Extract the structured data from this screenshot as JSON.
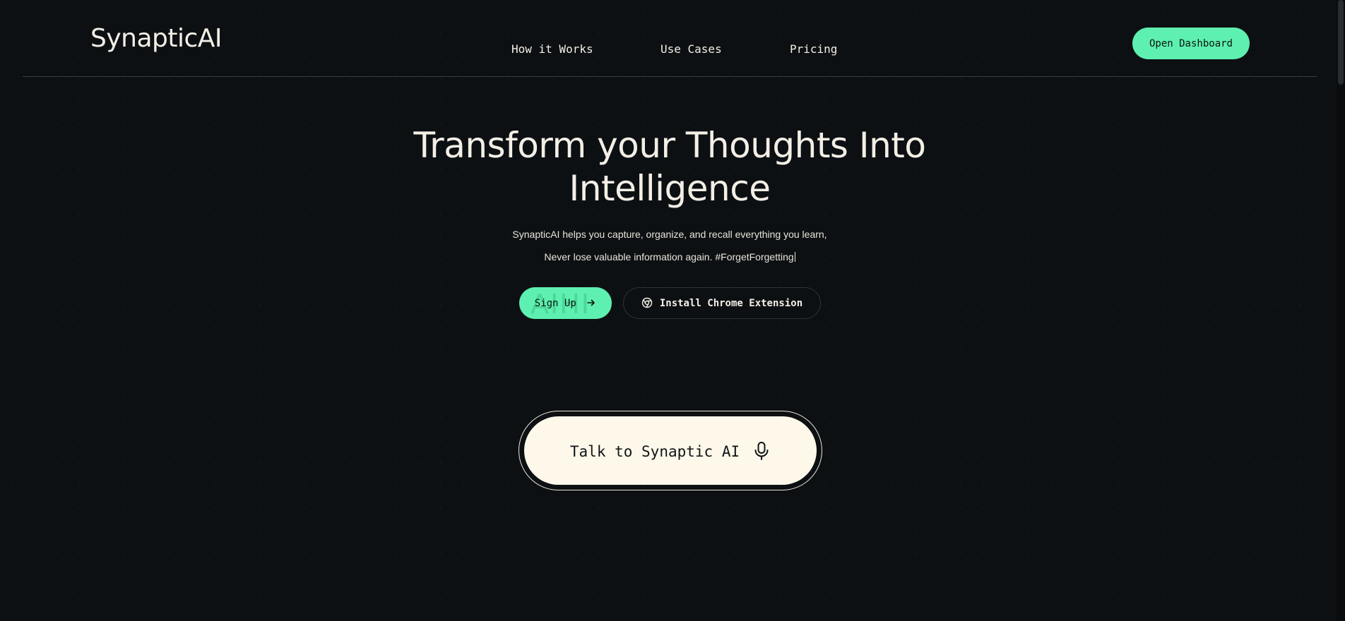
{
  "header": {
    "logo": "SynapticAI",
    "nav": [
      {
        "label": "How it Works"
      },
      {
        "label": "Use Cases"
      },
      {
        "label": "Pricing"
      }
    ],
    "cta_label": "Open Dashboard"
  },
  "hero": {
    "title_line1": "Transform your Thoughts Into",
    "title_line2": "Intelligence",
    "subtitle_line1": "SynapticAI helps you capture, organize, and recall everything you learn,",
    "subtitle_line2": "Never lose valuable information again. #ForgetForgetting",
    "signup_label": "Sign Up",
    "signup_icon": "arrow-right-icon",
    "chrome_label": "Install Chrome Extension",
    "chrome_icon": "chrome-icon"
  },
  "voice": {
    "label": "Talk to Synaptic AI",
    "icon": "microphone-icon"
  },
  "colors": {
    "background": "#0d1013",
    "accent": "#5ef0b0",
    "text": "#f3efe6",
    "voice_button": "#fdf8ea"
  }
}
